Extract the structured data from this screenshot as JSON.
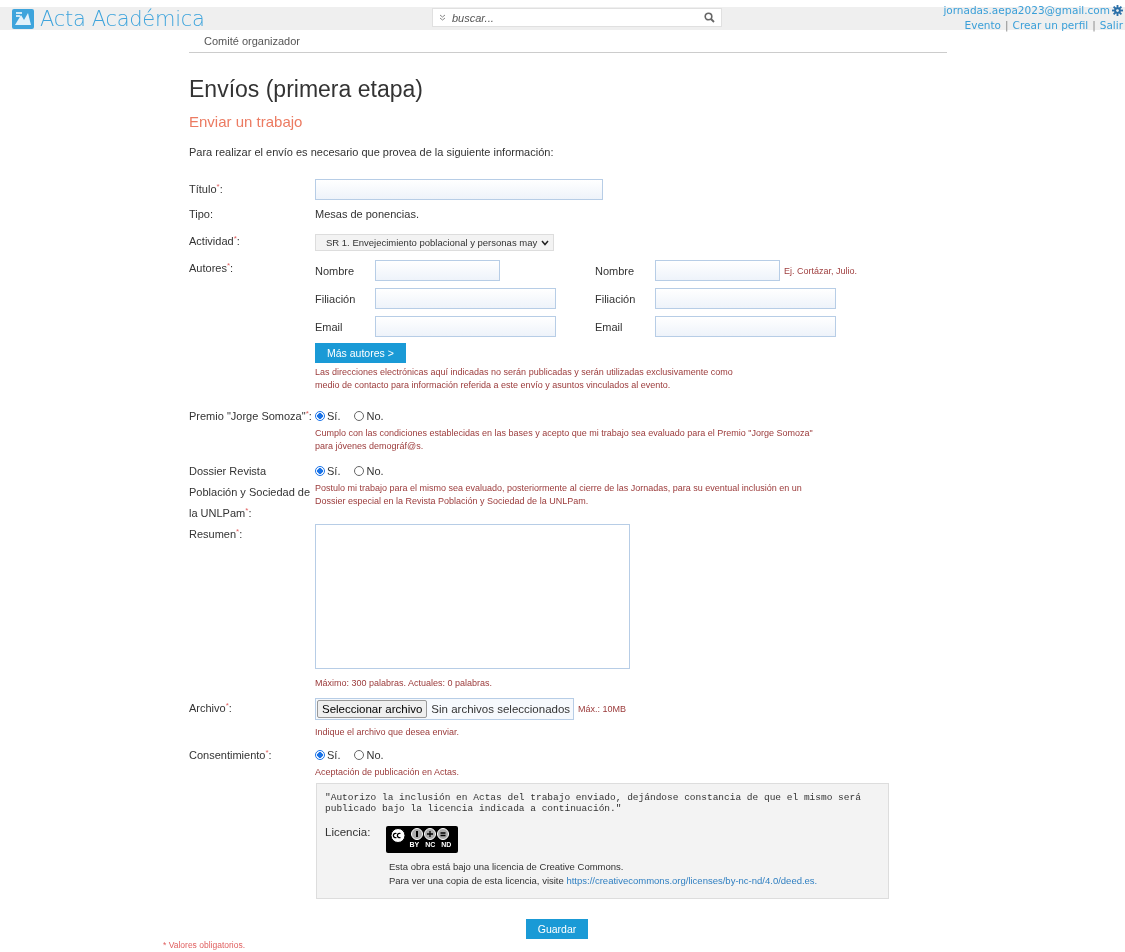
{
  "header": {
    "logo_text": "Acta Académica",
    "search": {
      "placeholder": "buscar..."
    },
    "user_email": "jornadas.aepa2023@gmail.com",
    "links": [
      "Evento",
      "Crear un perfil",
      "Salir"
    ],
    "separator": "|"
  },
  "breadcrumb": "Comité organizador",
  "title": "Envíos (primera etapa)",
  "subtitle": "Enviar un trabajo",
  "intro": "Para realizar el envío es necesario que provea de la siguiente información:",
  "required_mark": "*",
  "label_suffix": ":",
  "rows": [
    {
      "kind": "text",
      "label": "Título",
      "required": true
    },
    {
      "kind": "static",
      "label": "Tipo",
      "required": false,
      "value": "Mesas de ponencias."
    },
    {
      "kind": "select",
      "label": "Actividad",
      "required": true,
      "value": "SR 1. Envejecimiento poblacional y personas may"
    },
    {
      "kind": "authors",
      "label": "Autores",
      "required": true,
      "columns": [
        {
          "fields": [
            {
              "label": "Nombre"
            },
            {
              "label": "Filiación"
            },
            {
              "label": "Email"
            }
          ]
        },
        {
          "fields": [
            {
              "label": "Nombre",
              "hint": "Ej. Cortázar, Julio."
            },
            {
              "label": "Filiación"
            },
            {
              "label": "Email"
            }
          ]
        }
      ],
      "button": "Más autores >",
      "note": "Las direcciones electrónicas aquí indicadas no serán publicadas y serán utilizadas exclusivamente como medio de contacto para información referida a este envío y asuntos vinculados al evento."
    },
    {
      "kind": "radio",
      "label": "Premio \"Jorge Somoza\"",
      "required": true,
      "options": [
        {
          "label": "Sí.",
          "selected": true
        },
        {
          "label": "No.",
          "selected": false
        }
      ],
      "note": "Cumplo con las condiciones establecidas en las bases y acepto que mi trabajo sea evaluado para el Premio \"Jorge Somoza\" para jóvenes demográf@s."
    },
    {
      "kind": "radio",
      "label": "Dossier Revista Población y Sociedad de la UNLPam",
      "required": true,
      "options": [
        {
          "label": "Sí.",
          "selected": true
        },
        {
          "label": "No.",
          "selected": false
        }
      ],
      "note": "Postulo mi trabajo para el mismo sea evaluado, posteriormente al cierre de las Jornadas, para su eventual inclusión en un Dossier especial en la Revista Población y Sociedad de la UNLPam."
    },
    {
      "kind": "textarea",
      "label": "Resumen",
      "required": true,
      "note": "Máximo: 300 palabras. Actuales: 0 palabras."
    },
    {
      "kind": "file",
      "label": "Archivo",
      "required": true,
      "button": "Seleccionar archivo",
      "status": "Sin archivos seleccionados",
      "limit": "Máx.: 10MB",
      "note": "Indique el archivo que desea enviar."
    },
    {
      "kind": "radio",
      "label": "Consentimiento",
      "required": true,
      "options": [
        {
          "label": "Sí.",
          "selected": true
        },
        {
          "label": "No.",
          "selected": false
        }
      ],
      "note": "Aceptación de publicación en Actas."
    }
  ],
  "consent_box": {
    "quote": "\"Autorizo la inclusión en Actas del trabajo enviado, dejándose constancia de que el mismo será publicado bajo la licencia indicada a continuación.\"",
    "license_label": "Licencia:",
    "badge_terms": [
      "BY",
      "NC",
      "ND"
    ],
    "license_text": "Esta obra está bajo una licencia de Creative Commons.",
    "link_prefix": "Para ver una copia de esta licencia, visite",
    "link": "https://creativecommons.org/licenses/by-nc-nd/4.0/deed.es."
  },
  "save_button": "Guardar",
  "footer_note": "* Valores obligatorios."
}
